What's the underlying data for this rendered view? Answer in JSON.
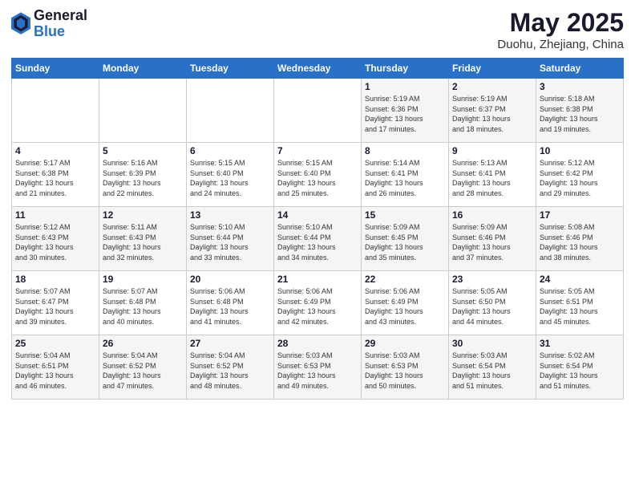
{
  "header": {
    "logo_general": "General",
    "logo_blue": "Blue",
    "title": "May 2025",
    "subtitle": "Duohu, Zhejiang, China"
  },
  "days_of_week": [
    "Sunday",
    "Monday",
    "Tuesday",
    "Wednesday",
    "Thursday",
    "Friday",
    "Saturday"
  ],
  "weeks": [
    [
      {
        "day": "",
        "info": ""
      },
      {
        "day": "",
        "info": ""
      },
      {
        "day": "",
        "info": ""
      },
      {
        "day": "",
        "info": ""
      },
      {
        "day": "1",
        "info": "Sunrise: 5:19 AM\nSunset: 6:36 PM\nDaylight: 13 hours\nand 17 minutes."
      },
      {
        "day": "2",
        "info": "Sunrise: 5:19 AM\nSunset: 6:37 PM\nDaylight: 13 hours\nand 18 minutes."
      },
      {
        "day": "3",
        "info": "Sunrise: 5:18 AM\nSunset: 6:38 PM\nDaylight: 13 hours\nand 19 minutes."
      }
    ],
    [
      {
        "day": "4",
        "info": "Sunrise: 5:17 AM\nSunset: 6:38 PM\nDaylight: 13 hours\nand 21 minutes."
      },
      {
        "day": "5",
        "info": "Sunrise: 5:16 AM\nSunset: 6:39 PM\nDaylight: 13 hours\nand 22 minutes."
      },
      {
        "day": "6",
        "info": "Sunrise: 5:15 AM\nSunset: 6:40 PM\nDaylight: 13 hours\nand 24 minutes."
      },
      {
        "day": "7",
        "info": "Sunrise: 5:15 AM\nSunset: 6:40 PM\nDaylight: 13 hours\nand 25 minutes."
      },
      {
        "day": "8",
        "info": "Sunrise: 5:14 AM\nSunset: 6:41 PM\nDaylight: 13 hours\nand 26 minutes."
      },
      {
        "day": "9",
        "info": "Sunrise: 5:13 AM\nSunset: 6:41 PM\nDaylight: 13 hours\nand 28 minutes."
      },
      {
        "day": "10",
        "info": "Sunrise: 5:12 AM\nSunset: 6:42 PM\nDaylight: 13 hours\nand 29 minutes."
      }
    ],
    [
      {
        "day": "11",
        "info": "Sunrise: 5:12 AM\nSunset: 6:43 PM\nDaylight: 13 hours\nand 30 minutes."
      },
      {
        "day": "12",
        "info": "Sunrise: 5:11 AM\nSunset: 6:43 PM\nDaylight: 13 hours\nand 32 minutes."
      },
      {
        "day": "13",
        "info": "Sunrise: 5:10 AM\nSunset: 6:44 PM\nDaylight: 13 hours\nand 33 minutes."
      },
      {
        "day": "14",
        "info": "Sunrise: 5:10 AM\nSunset: 6:44 PM\nDaylight: 13 hours\nand 34 minutes."
      },
      {
        "day": "15",
        "info": "Sunrise: 5:09 AM\nSunset: 6:45 PM\nDaylight: 13 hours\nand 35 minutes."
      },
      {
        "day": "16",
        "info": "Sunrise: 5:09 AM\nSunset: 6:46 PM\nDaylight: 13 hours\nand 37 minutes."
      },
      {
        "day": "17",
        "info": "Sunrise: 5:08 AM\nSunset: 6:46 PM\nDaylight: 13 hours\nand 38 minutes."
      }
    ],
    [
      {
        "day": "18",
        "info": "Sunrise: 5:07 AM\nSunset: 6:47 PM\nDaylight: 13 hours\nand 39 minutes."
      },
      {
        "day": "19",
        "info": "Sunrise: 5:07 AM\nSunset: 6:48 PM\nDaylight: 13 hours\nand 40 minutes."
      },
      {
        "day": "20",
        "info": "Sunrise: 5:06 AM\nSunset: 6:48 PM\nDaylight: 13 hours\nand 41 minutes."
      },
      {
        "day": "21",
        "info": "Sunrise: 5:06 AM\nSunset: 6:49 PM\nDaylight: 13 hours\nand 42 minutes."
      },
      {
        "day": "22",
        "info": "Sunrise: 5:06 AM\nSunset: 6:49 PM\nDaylight: 13 hours\nand 43 minutes."
      },
      {
        "day": "23",
        "info": "Sunrise: 5:05 AM\nSunset: 6:50 PM\nDaylight: 13 hours\nand 44 minutes."
      },
      {
        "day": "24",
        "info": "Sunrise: 5:05 AM\nSunset: 6:51 PM\nDaylight: 13 hours\nand 45 minutes."
      }
    ],
    [
      {
        "day": "25",
        "info": "Sunrise: 5:04 AM\nSunset: 6:51 PM\nDaylight: 13 hours\nand 46 minutes."
      },
      {
        "day": "26",
        "info": "Sunrise: 5:04 AM\nSunset: 6:52 PM\nDaylight: 13 hours\nand 47 minutes."
      },
      {
        "day": "27",
        "info": "Sunrise: 5:04 AM\nSunset: 6:52 PM\nDaylight: 13 hours\nand 48 minutes."
      },
      {
        "day": "28",
        "info": "Sunrise: 5:03 AM\nSunset: 6:53 PM\nDaylight: 13 hours\nand 49 minutes."
      },
      {
        "day": "29",
        "info": "Sunrise: 5:03 AM\nSunset: 6:53 PM\nDaylight: 13 hours\nand 50 minutes."
      },
      {
        "day": "30",
        "info": "Sunrise: 5:03 AM\nSunset: 6:54 PM\nDaylight: 13 hours\nand 51 minutes."
      },
      {
        "day": "31",
        "info": "Sunrise: 5:02 AM\nSunset: 6:54 PM\nDaylight: 13 hours\nand 51 minutes."
      }
    ]
  ]
}
